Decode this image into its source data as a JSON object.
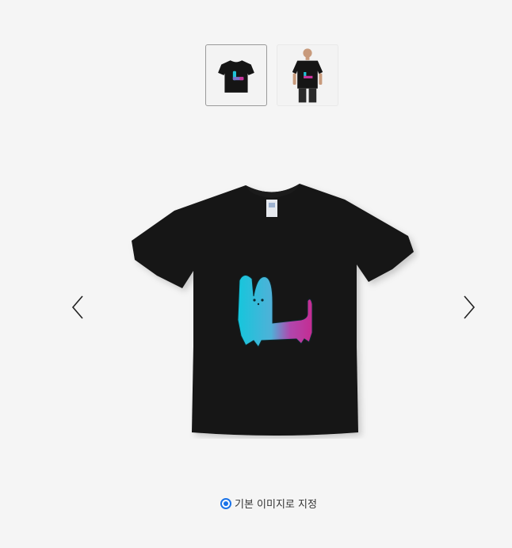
{
  "gallery": {
    "thumbnails": [
      {
        "icon": "black-tshirt-dog-print-icon",
        "selected": true
      },
      {
        "icon": "model-wearing-tshirt-icon",
        "selected": false
      }
    ],
    "main_image_icon": "black-tshirt-dog-print-icon",
    "prev_icon": "chevron-left-icon",
    "next_icon": "chevron-right-icon"
  },
  "default_image": {
    "label": "기본 이미지로 지정",
    "checked": true
  },
  "colors": {
    "accent": "#1a73e8",
    "shirt": "#111111",
    "print_cyan": "#1ec3d7",
    "print_magenta": "#c8339b"
  }
}
